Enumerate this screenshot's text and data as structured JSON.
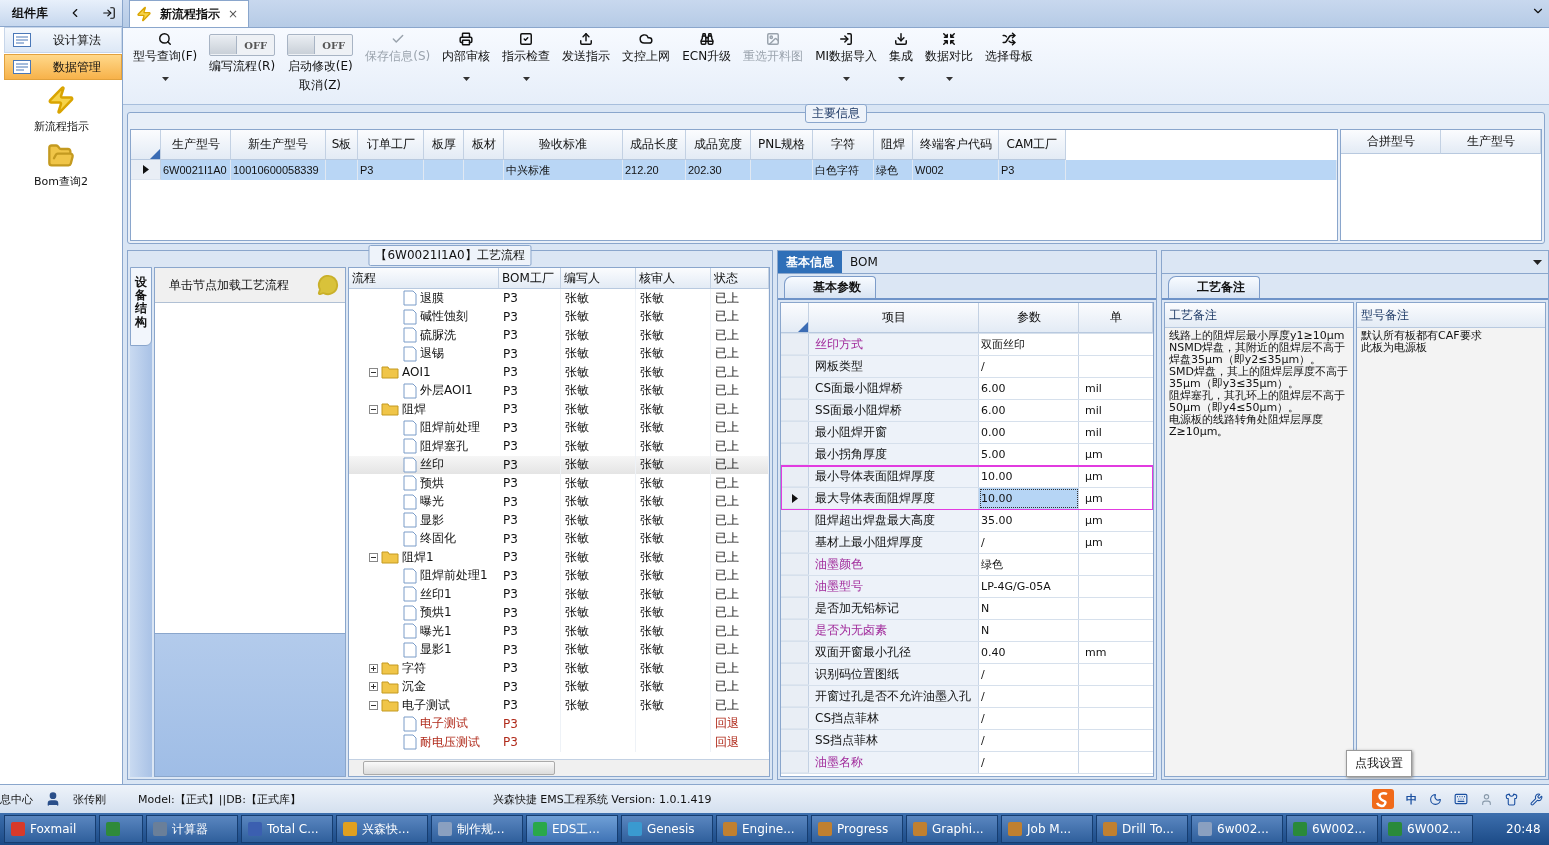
{
  "sidebar": {
    "title": "组件库",
    "items": [
      {
        "label": "设计算法",
        "selected": false
      },
      {
        "label": "数据管理",
        "selected": true
      }
    ],
    "launchers": [
      {
        "label": "新流程指示"
      },
      {
        "label": "Bom查询2"
      }
    ]
  },
  "tabs": [
    {
      "label": "新流程指示",
      "selected": true,
      "close": "×"
    }
  ],
  "toolbar": [
    {
      "kind": "button",
      "label": "型号查询(F)",
      "disabled": false,
      "dropdown": true
    },
    {
      "kind": "toggle",
      "on": false,
      "state_text": "OFF",
      "label": "编写流程(R)"
    },
    {
      "kind": "toggle",
      "on": false,
      "state_text": "OFF",
      "label": "启动修改(E)",
      "sublabel": "取消(Z)"
    },
    {
      "kind": "button",
      "label": "保存信息(S)",
      "disabled": true,
      "dropdown": false
    },
    {
      "kind": "button",
      "label": "内部审核",
      "disabled": false,
      "dropdown": true
    },
    {
      "kind": "button",
      "label": "指示检查",
      "disabled": false,
      "dropdown": true
    },
    {
      "kind": "button",
      "label": "发送指示",
      "disabled": false,
      "dropdown": false
    },
    {
      "kind": "button",
      "label": "文控上网",
      "disabled": false,
      "dropdown": false
    },
    {
      "kind": "button",
      "label": "ECN升级",
      "disabled": false,
      "dropdown": false
    },
    {
      "kind": "button",
      "label": "重选开料图",
      "disabled": true,
      "dropdown": false
    },
    {
      "kind": "button",
      "label": "MI数据导入",
      "disabled": false,
      "dropdown": true
    },
    {
      "kind": "button",
      "label": "集成",
      "disabled": false,
      "dropdown": true
    },
    {
      "kind": "button",
      "label": "数据对比",
      "disabled": false,
      "dropdown": true
    },
    {
      "kind": "button",
      "label": "选择母板",
      "disabled": false,
      "dropdown": false
    }
  ],
  "main_info": {
    "title": "主要信息",
    "columns": [
      "生产型号",
      "新生产型号",
      "S板",
      "订单工厂",
      "板厚",
      "板材",
      "验收标准",
      "成品长度",
      "成品宽度",
      "PNL规格",
      "字符",
      "阻焊",
      "终端客户代码",
      "CAM工厂"
    ],
    "rows": [
      {
        "selected": true,
        "cells": [
          "6W0021I1A0",
          "10010600058339",
          null,
          "P3",
          null,
          null,
          "中兴标准",
          "212.20",
          "202.30",
          null,
          "白色字符",
          "绿色",
          "W002",
          "P3"
        ]
      }
    ],
    "side_columns": [
      "合拼型号",
      "生产型号"
    ]
  },
  "flow_panel": {
    "title": "【6W0021I1A0】工艺流程",
    "side_tab": "设备结构",
    "hint": "单击节点加载工艺流程",
    "columns": [
      "流程",
      "BOM工厂",
      "编写人",
      "核审人",
      "状态"
    ],
    "nodes": [
      {
        "kind": "leaf",
        "label": "退膜",
        "bom": "P3",
        "author": "张敏",
        "reviewer": "张敏",
        "status": "已上",
        "returned": false,
        "selected": false
      },
      {
        "kind": "leaf",
        "label": "碱性蚀刻",
        "bom": "P3",
        "author": "张敏",
        "reviewer": "张敏",
        "status": "已上",
        "returned": false,
        "selected": false
      },
      {
        "kind": "leaf",
        "label": "硫脲洗",
        "bom": "P3",
        "author": "张敏",
        "reviewer": "张敏",
        "status": "已上",
        "returned": false,
        "selected": false
      },
      {
        "kind": "leaf",
        "label": "退锡",
        "bom": "P3",
        "author": "张敏",
        "reviewer": "张敏",
        "status": "已上",
        "returned": false,
        "selected": false
      },
      {
        "kind": "folder",
        "label": "AOI1",
        "bom": "P3",
        "author": "张敏",
        "reviewer": "张敏",
        "status": "已上",
        "returned": false,
        "selected": false,
        "expanded": true,
        "children": [
          {
            "kind": "leaf",
            "label": "外层AOI1",
            "bom": "P3",
            "author": "张敏",
            "reviewer": "张敏",
            "status": "已上",
            "returned": false,
            "selected": false
          }
        ]
      },
      {
        "kind": "folder",
        "label": "阻焊",
        "bom": "P3",
        "author": "张敏",
        "reviewer": "张敏",
        "status": "已上",
        "returned": false,
        "selected": false,
        "expanded": true,
        "children": [
          {
            "kind": "leaf",
            "label": "阻焊前处理",
            "bom": "P3",
            "author": "张敏",
            "reviewer": "张敏",
            "status": "已上",
            "returned": false,
            "selected": false
          },
          {
            "kind": "leaf",
            "label": "阻焊塞孔",
            "bom": "P3",
            "author": "张敏",
            "reviewer": "张敏",
            "status": "已上",
            "returned": false,
            "selected": false
          },
          {
            "kind": "leaf",
            "label": "丝印",
            "bom": "P3",
            "author": "张敏",
            "reviewer": "张敏",
            "status": "已上",
            "returned": false,
            "selected": true
          },
          {
            "kind": "leaf",
            "label": "预烘",
            "bom": "P3",
            "author": "张敏",
            "reviewer": "张敏",
            "status": "已上",
            "returned": false,
            "selected": false
          },
          {
            "kind": "leaf",
            "label": "曝光",
            "bom": "P3",
            "author": "张敏",
            "reviewer": "张敏",
            "status": "已上",
            "returned": false,
            "selected": false
          },
          {
            "kind": "leaf",
            "label": "显影",
            "bom": "P3",
            "author": "张敏",
            "reviewer": "张敏",
            "status": "已上",
            "returned": false,
            "selected": false
          },
          {
            "kind": "leaf",
            "label": "终固化",
            "bom": "P3",
            "author": "张敏",
            "reviewer": "张敏",
            "status": "已上",
            "returned": false,
            "selected": false
          }
        ]
      },
      {
        "kind": "folder",
        "label": "阻焊1",
        "bom": "P3",
        "author": "张敏",
        "reviewer": "张敏",
        "status": "已上",
        "returned": false,
        "selected": false,
        "expanded": true,
        "children": [
          {
            "kind": "leaf",
            "label": "阻焊前处理1",
            "bom": "P3",
            "author": "张敏",
            "reviewer": "张敏",
            "status": "已上",
            "returned": false,
            "selected": false
          },
          {
            "kind": "leaf",
            "label": "丝印1",
            "bom": "P3",
            "author": "张敏",
            "reviewer": "张敏",
            "status": "已上",
            "returned": false,
            "selected": false
          },
          {
            "kind": "leaf",
            "label": "预烘1",
            "bom": "P3",
            "author": "张敏",
            "reviewer": "张敏",
            "status": "已上",
            "returned": false,
            "selected": false
          },
          {
            "kind": "leaf",
            "label": "曝光1",
            "bom": "P3",
            "author": "张敏",
            "reviewer": "张敏",
            "status": "已上",
            "returned": false,
            "selected": false
          },
          {
            "kind": "leaf",
            "label": "显影1",
            "bom": "P3",
            "author": "张敏",
            "reviewer": "张敏",
            "status": "已上",
            "returned": false,
            "selected": false
          }
        ]
      },
      {
        "kind": "folder",
        "label": "字符",
        "bom": "P3",
        "author": "张敏",
        "reviewer": "张敏",
        "status": "已上",
        "returned": false,
        "selected": false,
        "expanded": false
      },
      {
        "kind": "folder",
        "label": "沉金",
        "bom": "P3",
        "author": "张敏",
        "reviewer": "张敏",
        "status": "已上",
        "returned": false,
        "selected": false,
        "expanded": false
      },
      {
        "kind": "folder",
        "label": "电子测试",
        "bom": "P3",
        "author": "张敏",
        "reviewer": "张敏",
        "status": "已上",
        "returned": false,
        "selected": false,
        "expanded": true,
        "children": [
          {
            "kind": "leaf",
            "label": "电子测试",
            "bom": "P3",
            "status": "回退",
            "returned": true,
            "selected": false
          },
          {
            "kind": "leaf",
            "label": "耐电压测试",
            "bom": "P3",
            "status": "回退",
            "returned": true,
            "selected": false
          }
        ]
      }
    ]
  },
  "params_panel": {
    "tabs": [
      {
        "label": "基本信息",
        "selected": true
      },
      {
        "label": "BOM",
        "selected": false
      }
    ],
    "sub_tab": "基本参数",
    "columns": [
      "项目",
      "参数",
      "单"
    ],
    "rows": [
      {
        "item": "丝印方式",
        "value": "双面丝印",
        "emphasized": true,
        "selected": false,
        "boxed": false
      },
      {
        "item": "网板类型",
        "value": "/",
        "emphasized": false,
        "selected": false,
        "boxed": false
      },
      {
        "item": "CS面最小阻焊桥",
        "value": "6.00",
        "unit": "mil",
        "emphasized": false,
        "selected": false,
        "boxed": false
      },
      {
        "item": "SS面最小阻焊桥",
        "value": "6.00",
        "unit": "mil",
        "emphasized": false,
        "selected": false,
        "boxed": false
      },
      {
        "item": "最小阻焊开窗",
        "value": "0.00",
        "unit": "mil",
        "emphasized": false,
        "selected": false,
        "boxed": false
      },
      {
        "item": "最小拐角厚度",
        "value": "5.00",
        "unit": "μm",
        "emphasized": false,
        "selected": false,
        "boxed": false
      },
      {
        "item": "最小导体表面阻焊厚度",
        "value": "10.00",
        "unit": "μm",
        "emphasized": false,
        "selected": false,
        "boxed": true
      },
      {
        "item": "最大导体表面阻焊厚度",
        "value": "10.00",
        "unit": "μm",
        "emphasized": false,
        "selected": true,
        "boxed": true
      },
      {
        "item": "阻焊超出焊盘最大高度",
        "value": "35.00",
        "unit": "μm",
        "emphasized": false,
        "selected": false,
        "boxed": false
      },
      {
        "item": "基材上最小阻焊厚度",
        "value": "/",
        "unit": "μm",
        "emphasized": false,
        "selected": false,
        "boxed": false
      },
      {
        "item": "油墨颜色",
        "value": "绿色",
        "emphasized": true,
        "selected": false,
        "boxed": false
      },
      {
        "item": "油墨型号",
        "value": "LP-4G/G-05A",
        "emphasized": true,
        "selected": false,
        "boxed": false
      },
      {
        "item": "是否加无铅标记",
        "value": "N",
        "emphasized": false,
        "selected": false,
        "boxed": false
      },
      {
        "item": "是否为无卤素",
        "value": "N",
        "emphasized": true,
        "selected": false,
        "boxed": false
      },
      {
        "item": "双面开窗最小孔径",
        "value": "0.40",
        "unit": "mm",
        "emphasized": false,
        "selected": false,
        "boxed": false
      },
      {
        "item": "识别码位置图纸",
        "value": "/",
        "emphasized": false,
        "selected": false,
        "boxed": false
      },
      {
        "item": "开窗过孔是否不允许油墨入孔",
        "value": "/",
        "emphasized": false,
        "selected": false,
        "boxed": false
      },
      {
        "item": "CS挡点菲林",
        "value": "/",
        "emphasized": false,
        "selected": false,
        "boxed": false
      },
      {
        "item": "SS挡点菲林",
        "value": "/",
        "emphasized": false,
        "selected": false,
        "boxed": false
      },
      {
        "item": "油墨名称",
        "value": "/",
        "emphasized": true,
        "selected": false,
        "boxed": false
      }
    ]
  },
  "notes_panel": {
    "sub_tab": "工艺备注",
    "columns": [
      "工艺备注",
      "型号备注"
    ],
    "process_notes": [
      "线路上的阻焊层最小厚度y1≥10μm",
      "NSMD焊盘，其附近的阻焊层不高于焊盘35μm（即y2≤35μm）。",
      "SMD焊盘，其上的阻焊层厚度不高于35μm（即y3≤35μm）。",
      "阻焊塞孔，其孔环上的阻焊层不高于50μm（即y4≤50μm）。",
      "电源板的线路转角处阻焊层厚度Z≥10μm。"
    ],
    "model_notes": [
      "默认所有板都有CAF要求",
      "此板为电源板"
    ],
    "popup": "点我设置"
  },
  "status_bar": {
    "left": "息中心",
    "user": "张传刚",
    "db": "Model:【正式】||DB:【正式库】",
    "version": "兴森快捷 EMS工程系统 Version: 1.0.1.419",
    "ime": "中"
  },
  "taskbar": {
    "items": [
      {
        "label": "Foxmail",
        "color": "#d83a2a",
        "selected": false
      },
      {
        "color": "#2f8a3a",
        "selected": false
      },
      {
        "label": "计算器",
        "color": "#6a7f99",
        "selected": false
      },
      {
        "label": "Total C...",
        "color": "#3b5fb0",
        "selected": false
      },
      {
        "label": "兴森快...",
        "color": "#e0a020",
        "selected": false
      },
      {
        "label": "制作规...",
        "color": "#8aa0c0",
        "selected": false
      },
      {
        "label": "EDS工...",
        "color": "#2aa84a",
        "selected": true
      },
      {
        "label": "Genesis",
        "color": "#3a9ad0",
        "selected": false
      },
      {
        "label": "Engine...",
        "color": "#c08030",
        "selected": false
      },
      {
        "label": "Progress",
        "color": "#c08030",
        "selected": false
      },
      {
        "label": "Graphi...",
        "color": "#c08030",
        "selected": false
      },
      {
        "label": "Job M...",
        "color": "#c08030",
        "selected": false
      },
      {
        "label": "Drill To...",
        "color": "#c08030",
        "selected": false
      },
      {
        "label": "6w002...",
        "color": "#8aa0c0",
        "selected": false
      },
      {
        "label": "6W002...",
        "color": "#2a8a3a",
        "selected": false
      },
      {
        "label": "6W002...",
        "color": "#2a8a3a",
        "selected": false
      }
    ],
    "clock": "20:48"
  }
}
